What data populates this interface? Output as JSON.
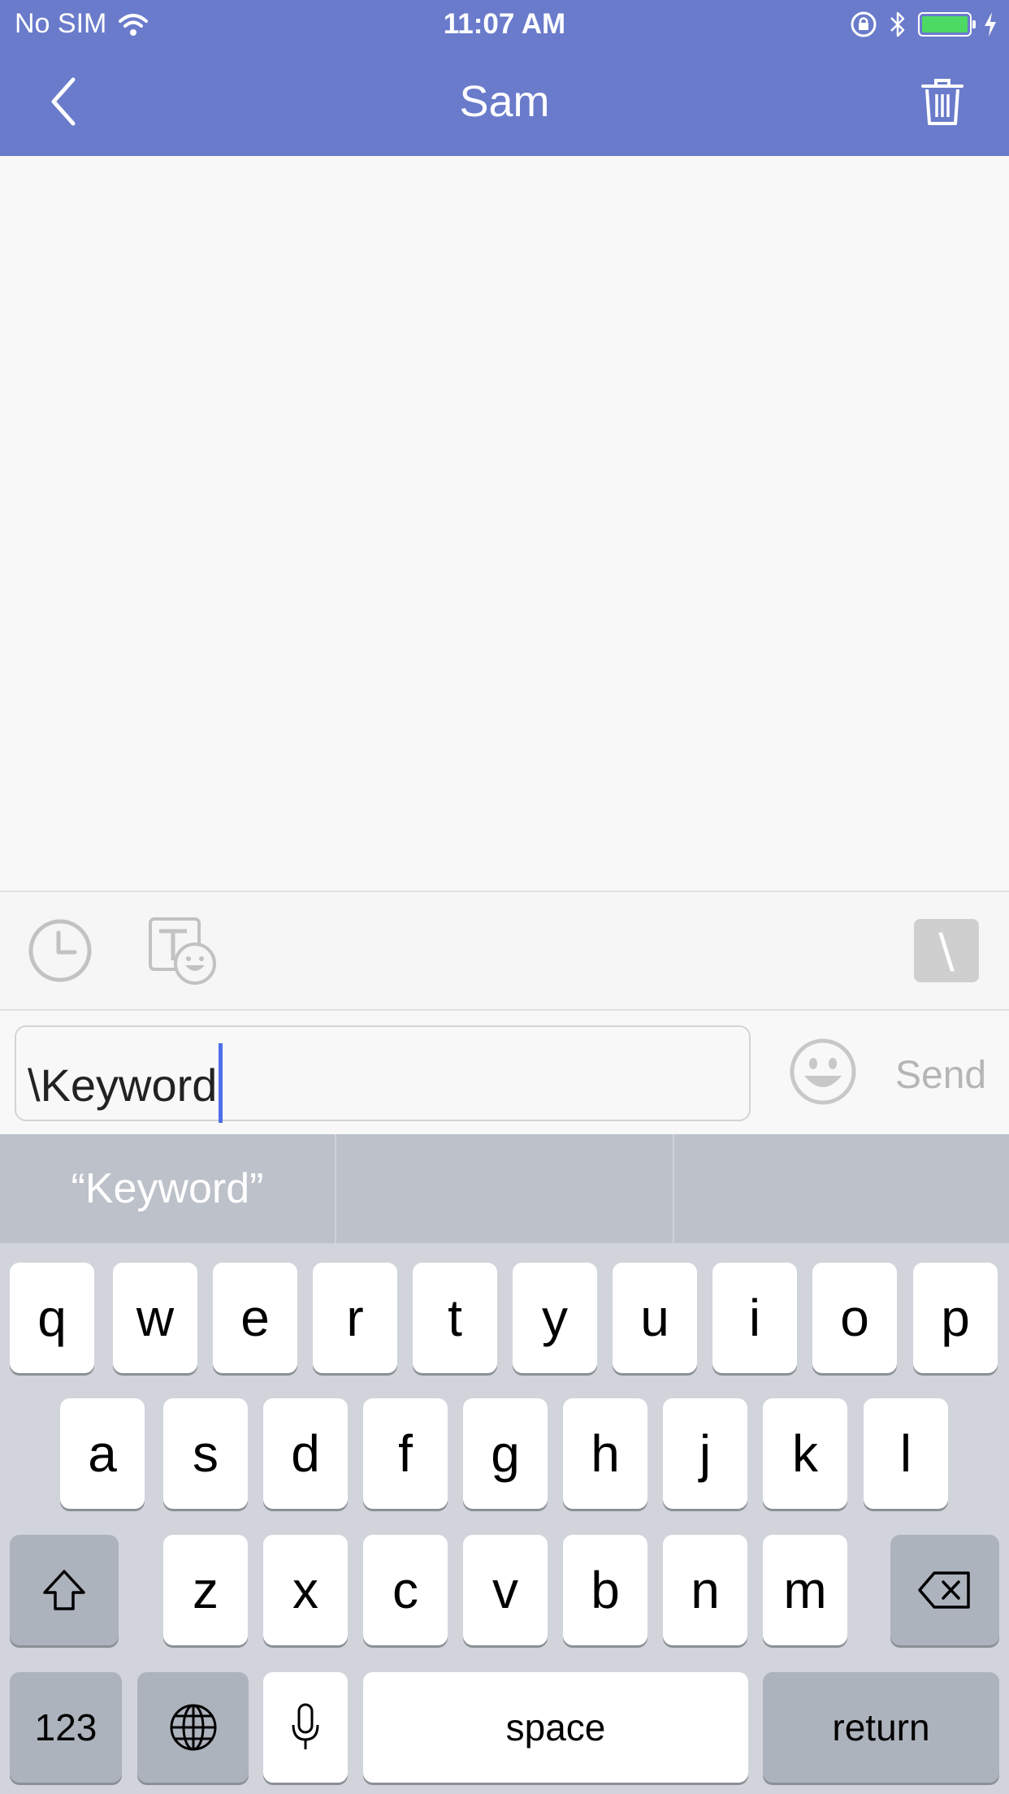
{
  "status_bar": {
    "carrier": "No SIM",
    "time": "11:07 AM"
  },
  "nav": {
    "title": "Sam"
  },
  "toolbar": {
    "slash_label": "\\"
  },
  "composer": {
    "input_value": "\\Keyword",
    "send_label": "Send"
  },
  "suggestions": [
    "“Keyword”",
    "",
    ""
  ],
  "keyboard": {
    "row1": [
      "q",
      "w",
      "e",
      "r",
      "t",
      "y",
      "u",
      "i",
      "o",
      "p"
    ],
    "row2": [
      "a",
      "s",
      "d",
      "f",
      "g",
      "h",
      "j",
      "k",
      "l"
    ],
    "row3": [
      "z",
      "x",
      "c",
      "v",
      "b",
      "n",
      "m"
    ],
    "numbers_label": "123",
    "space_label": "space",
    "return_label": "return"
  },
  "colors": {
    "header": "#6a7bcb",
    "battery": "#4cd964",
    "caret": "#4d6fe8"
  }
}
